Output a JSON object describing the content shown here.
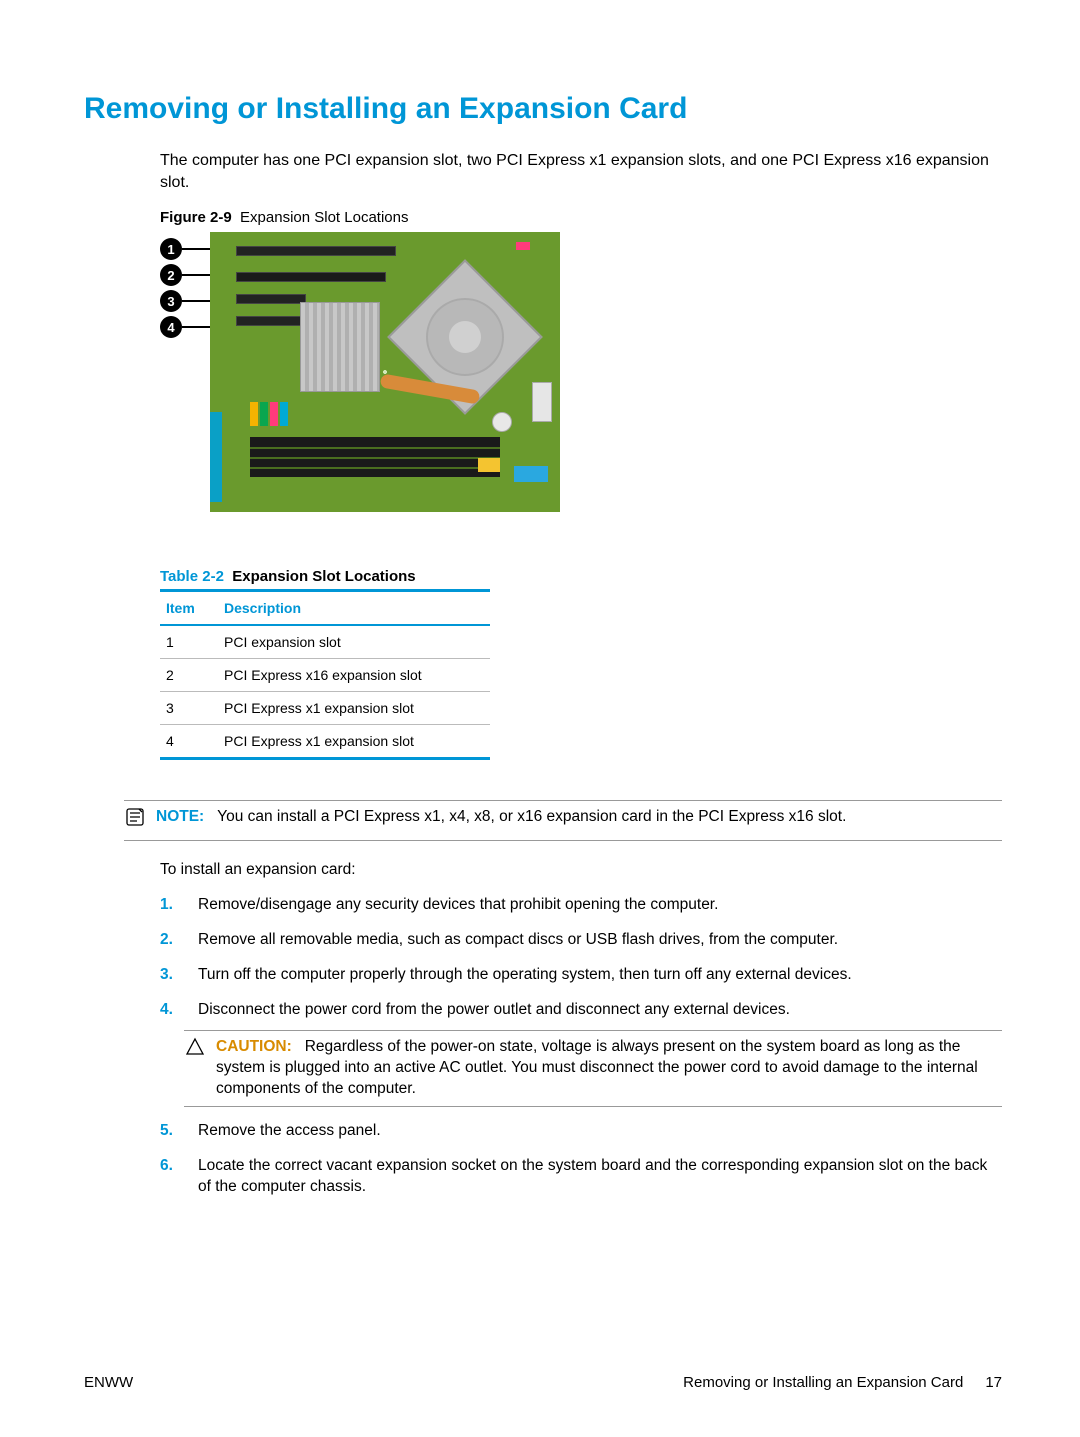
{
  "title": "Removing or Installing an Expansion Card",
  "intro": "The computer has one PCI expansion slot, two PCI Express x1 expansion slots, and one PCI Express x16 expansion slot.",
  "figure": {
    "label": "Figure 2-9",
    "caption": "Expansion Slot Locations",
    "callouts": [
      "1",
      "2",
      "3",
      "4"
    ]
  },
  "table": {
    "label": "Table 2-2",
    "caption": "Expansion Slot Locations",
    "headers": {
      "item": "Item",
      "desc": "Description"
    },
    "rows": [
      {
        "item": "1",
        "desc": "PCI expansion slot"
      },
      {
        "item": "2",
        "desc": "PCI Express x16 expansion slot"
      },
      {
        "item": "3",
        "desc": "PCI Express x1 expansion slot"
      },
      {
        "item": "4",
        "desc": "PCI Express x1 expansion slot"
      }
    ]
  },
  "note": {
    "label": "NOTE:",
    "text": "You can install a PCI Express x1, x4, x8, or x16 expansion card in the PCI Express x16 slot."
  },
  "lead_in": "To install an expansion card:",
  "steps": [
    "Remove/disengage any security devices that prohibit opening the computer.",
    "Remove all removable media, such as compact discs or USB flash drives, from the computer.",
    "Turn off the computer properly through the operating system, then turn off any external devices.",
    "Disconnect the power cord from the power outlet and disconnect any external devices.",
    "Remove the access panel.",
    "Locate the correct vacant expansion socket on the system board and the corresponding expansion slot on the back of the computer chassis."
  ],
  "caution": {
    "label": "CAUTION:",
    "text": "Regardless of the power-on state, voltage is always present on the system board as long as the system is plugged into an active AC outlet. You must disconnect the power cord to avoid damage to the internal components of the computer."
  },
  "footer": {
    "left": "ENWW",
    "section": "Removing or Installing an Expansion Card",
    "page": "17"
  }
}
